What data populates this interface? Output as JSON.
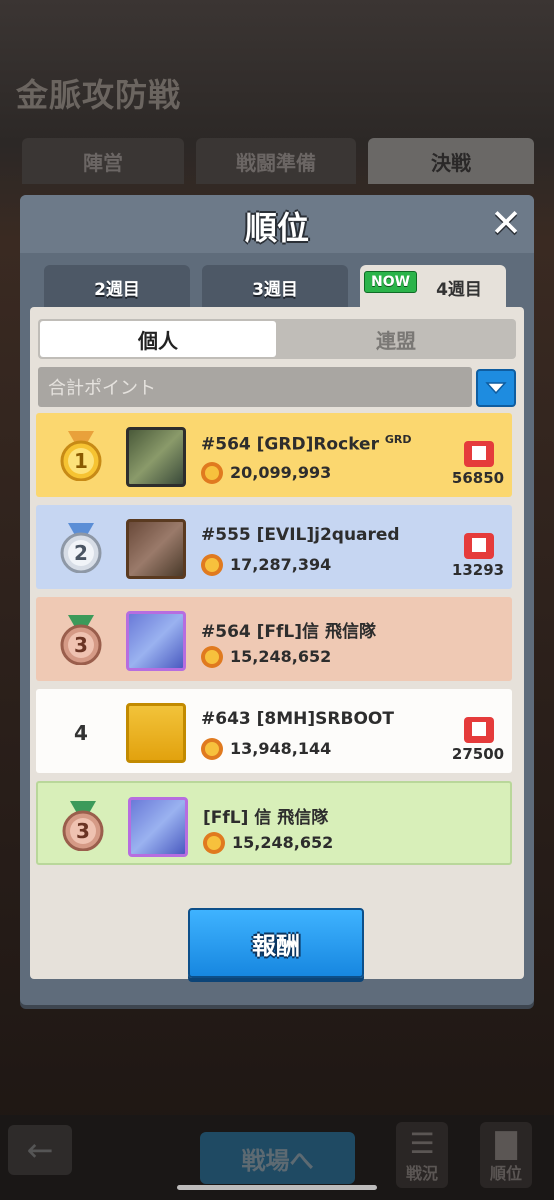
{
  "background": {
    "title": "金脈攻防戦",
    "tabs": [
      "陣営",
      "戦闘準備",
      "決戦"
    ]
  },
  "modal": {
    "title": "順位",
    "close_label": "✕",
    "week_tabs": [
      "2週目",
      "3週目",
      "4週目"
    ],
    "now_badge": "NOW",
    "segment": {
      "individual": "個人",
      "alliance": "連盟"
    },
    "sort_label": "合計ポイント",
    "rows": [
      {
        "rank": "1",
        "name": "#564 [GRD]Rocker",
        "tag": "GRD",
        "points": "20,099,993",
        "flag_count": "56850"
      },
      {
        "rank": "2",
        "name": "#555 [EVIL]j2quared",
        "points": "17,287,394",
        "flag_count": "13293"
      },
      {
        "rank": "3",
        "name": "#564 [FfL]信 飛信隊",
        "points": "15,248,652"
      },
      {
        "rank": "4",
        "name": "#643 [8MH]SRBOOT",
        "points": "13,948,144",
        "flag_count": "27500"
      },
      {
        "rank": "3",
        "name": "[FfL] 信 飛信隊",
        "points": "15,248,652"
      }
    ],
    "reward_label": "報酬"
  },
  "bottom_bar": {
    "battle_label": "戦場へ",
    "status_label": "戦況",
    "ranking_label": "順位"
  },
  "colors": {
    "gold_row": "#fbd76f",
    "silver_row": "#c6d6f2",
    "bronze_row": "#efc9b4",
    "self_row": "#d8efb9",
    "accent_blue": "#1e8ce0",
    "now_green": "#2bb34a"
  }
}
